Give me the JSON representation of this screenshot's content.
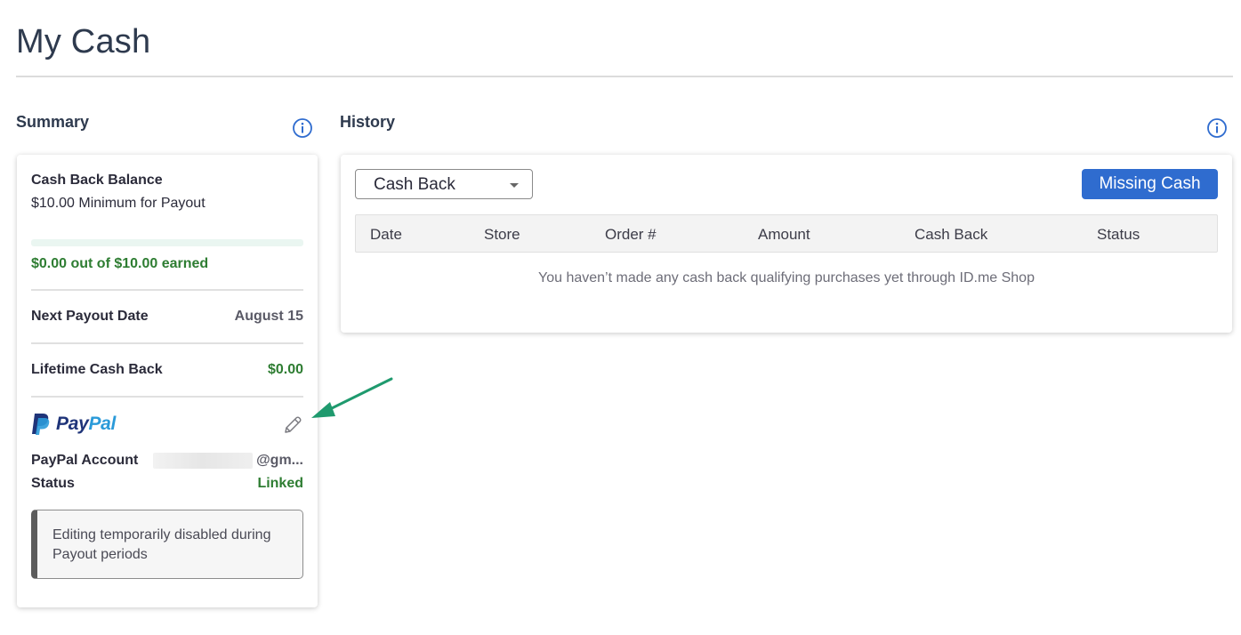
{
  "page": {
    "title": "My Cash"
  },
  "summary": {
    "heading": "Summary",
    "info_icon": "info-circle-icon",
    "cash_back_balance_label": "Cash Back Balance",
    "minimum_text": "$10.00 Minimum for Payout",
    "progress_fraction": 0,
    "earned_text": "$0.00 out of $10.00 earned",
    "next_payout_label": "Next Payout Date",
    "next_payout_value": "August 15",
    "lifetime_label": "Lifetime Cash Back",
    "lifetime_value": "$0.00",
    "paypal": {
      "logo_text_dark": "Pay",
      "logo_text_light": "Pal",
      "edit_icon": "pencil-icon",
      "account_label": "PayPal Account",
      "account_value": "@gm...",
      "status_label": "Status",
      "status_value": "Linked"
    },
    "notice": "Editing temporarily disabled during Payout periods"
  },
  "history": {
    "heading": "History",
    "info_icon": "info-circle-icon",
    "filter_selected": "Cash Back",
    "missing_cash_button": "Missing Cash",
    "columns": [
      "Date",
      "Store",
      "Order #",
      "Amount",
      "Cash Back",
      "Status"
    ],
    "empty_message": "You haven’t made any cash back qualifying purchases yet through ID.me Shop"
  },
  "colors": {
    "accent_blue": "#2f6ccf",
    "success_green": "#2e7d32",
    "annotation_arrow": "#1f9a6e",
    "paypal_dark": "#1f3479",
    "paypal_light": "#2a9ad9"
  }
}
